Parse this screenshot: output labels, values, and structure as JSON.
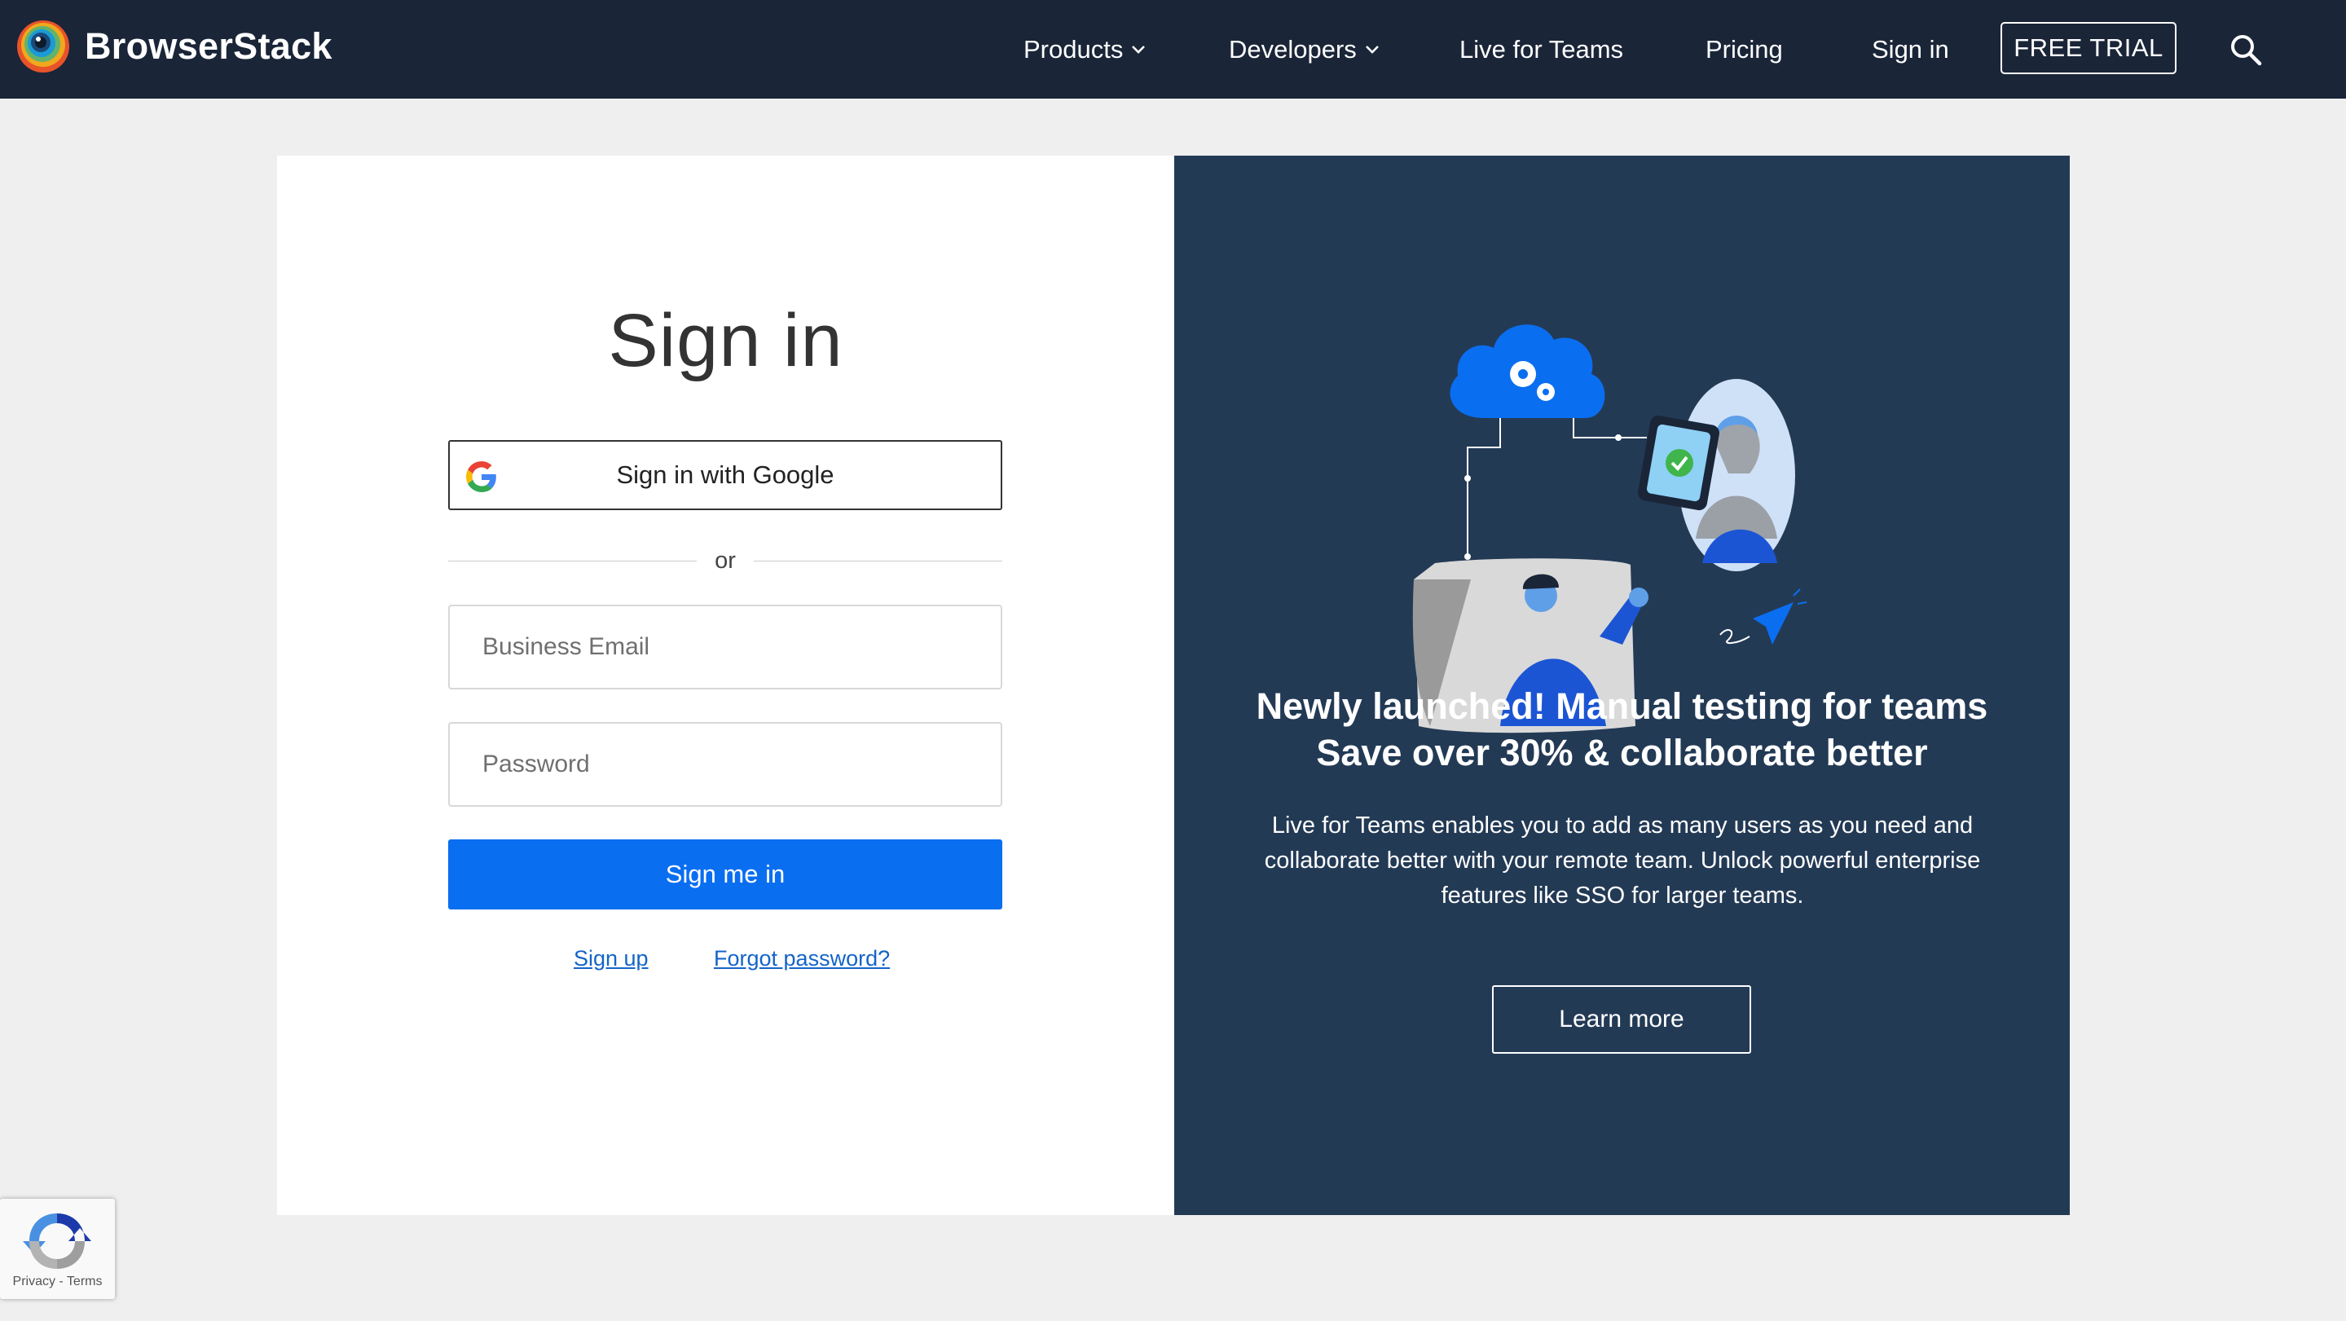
{
  "header": {
    "brand": "BrowserStack",
    "nav": [
      {
        "label": "Products",
        "has_dropdown": true
      },
      {
        "label": "Developers",
        "has_dropdown": true
      },
      {
        "label": "Live for Teams",
        "has_dropdown": false
      },
      {
        "label": "Pricing",
        "has_dropdown": false
      },
      {
        "label": "Sign in",
        "has_dropdown": false
      }
    ],
    "cta": "FREE TRIAL",
    "search_icon": "search-icon"
  },
  "signin": {
    "title": "Sign in",
    "google_button": "Sign in with Google",
    "divider": "or",
    "email_placeholder": "Business Email",
    "password_placeholder": "Password",
    "submit": "Sign me in",
    "signup_link": "Sign up",
    "forgot_link": "Forgot password?"
  },
  "promo": {
    "title_line1": "Newly launched! Manual testing for teams",
    "title_line2": "Save over 30% & collaborate better",
    "body": "Live for Teams enables you to add as many users as you need and collaborate better with your remote team. Unlock powerful enterprise features like SSO for larger teams.",
    "button": "Learn more"
  },
  "recaptcha": {
    "links": "Privacy - Terms"
  },
  "colors": {
    "nav_bg": "#1a2538",
    "promo_bg": "#233a55",
    "primary": "#0a6ef0",
    "page_bg": "#efefef"
  }
}
